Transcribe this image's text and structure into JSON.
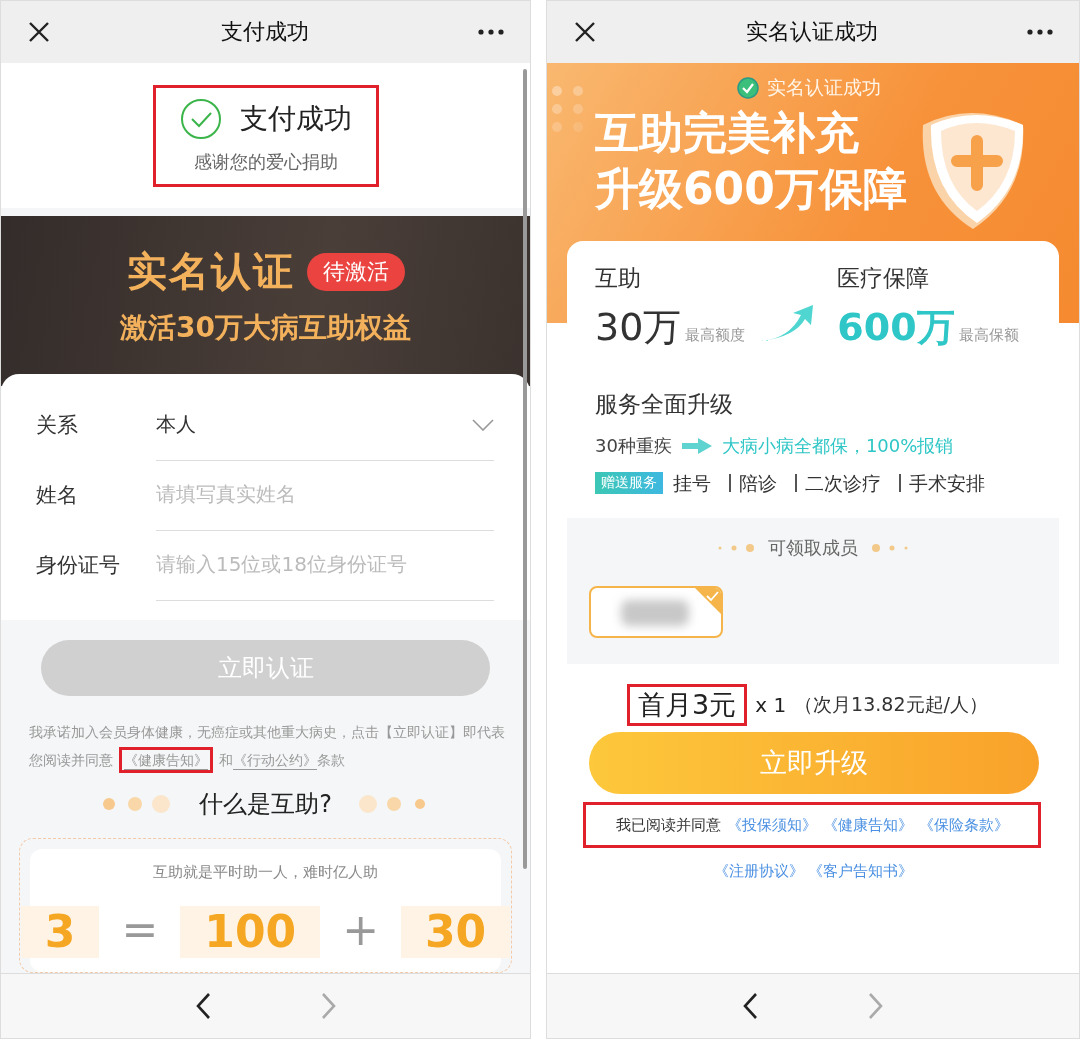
{
  "left_screen": {
    "nav_bar": {
      "title": "支付成功"
    },
    "success": {
      "title": "支付成功",
      "subtitle": "感谢您的爱心捐助",
      "highlighted": true
    },
    "banner": {
      "title": "实名认证",
      "badge": "待激活",
      "subtitle": "激活30万大病互助权益"
    },
    "form": [
      {
        "kind": "select",
        "label": "关系",
        "value": "本人"
      },
      {
        "kind": "text",
        "label": "姓名",
        "placeholder": "请填写真实姓名"
      },
      {
        "kind": "text",
        "label": "身份证号",
        "placeholder": "请输入15位或18位身份证号"
      }
    ],
    "submit_button": {
      "label": "立即认证",
      "disabled": true
    },
    "consent": [
      {
        "kind": "text",
        "text": "我承诺加入会员身体健康，无癌症或其他重大病史，点击【立即认证】即代表您阅读并同意"
      },
      {
        "kind": "link",
        "text": "《健康告知》",
        "highlighted": true
      },
      {
        "kind": "text",
        "text": "和"
      },
      {
        "kind": "link",
        "text": "《行动公约》",
        "highlighted": false
      },
      {
        "kind": "text",
        "text": "条款"
      }
    ],
    "section_title": "什么是互助?",
    "intro_card": {
      "tagline": "互助就是平时助一人，难时亿人助",
      "equation": [
        {
          "kind": "number",
          "value": "3"
        },
        {
          "kind": "operator",
          "value": "="
        },
        {
          "kind": "number",
          "value": "100"
        },
        {
          "kind": "operator",
          "value": "+"
        },
        {
          "kind": "number",
          "value": "30"
        }
      ]
    },
    "toolbar": {
      "back_enabled": true,
      "forward_enabled": false
    }
  },
  "right_screen": {
    "nav_bar": {
      "title": "实名认证成功"
    },
    "banner": {
      "status": "实名认证成功",
      "headline": [
        "互助完美补充",
        "升级600万保障"
      ]
    },
    "comparison": [
      {
        "title": "互助",
        "amount": "30万",
        "note": "最高额度",
        "highlighted": false
      },
      {
        "title": "医疗保障",
        "amount": "600万",
        "note": "最高保额",
        "highlighted": true
      }
    ],
    "services": {
      "title": "服务全面升级",
      "from": "30种重疾",
      "to": "大病小病全都保，100%报销",
      "badge": "赠送服务",
      "items": [
        "挂号",
        "陪诊",
        "二次诊疗",
        "手术安排"
      ]
    },
    "members": {
      "title": "可领取成员",
      "items": [
        {
          "selected": true
        }
      ]
    },
    "price": {
      "offer": "首月3元",
      "highlighted": true,
      "quantity": "x 1",
      "note": "（次月13.82元起/人）"
    },
    "upgrade_button": {
      "label": "立即升级"
    },
    "agreement": {
      "text": "我已阅读并同意",
      "highlighted": true,
      "links": [
        "《投保须知》",
        "《健康告知》",
        "《保险条款》"
      ]
    },
    "more_links": [
      "《注册协议》",
      "《客户告知书》"
    ],
    "toolbar": {
      "back_enabled": true,
      "forward_enabled": false
    }
  }
}
